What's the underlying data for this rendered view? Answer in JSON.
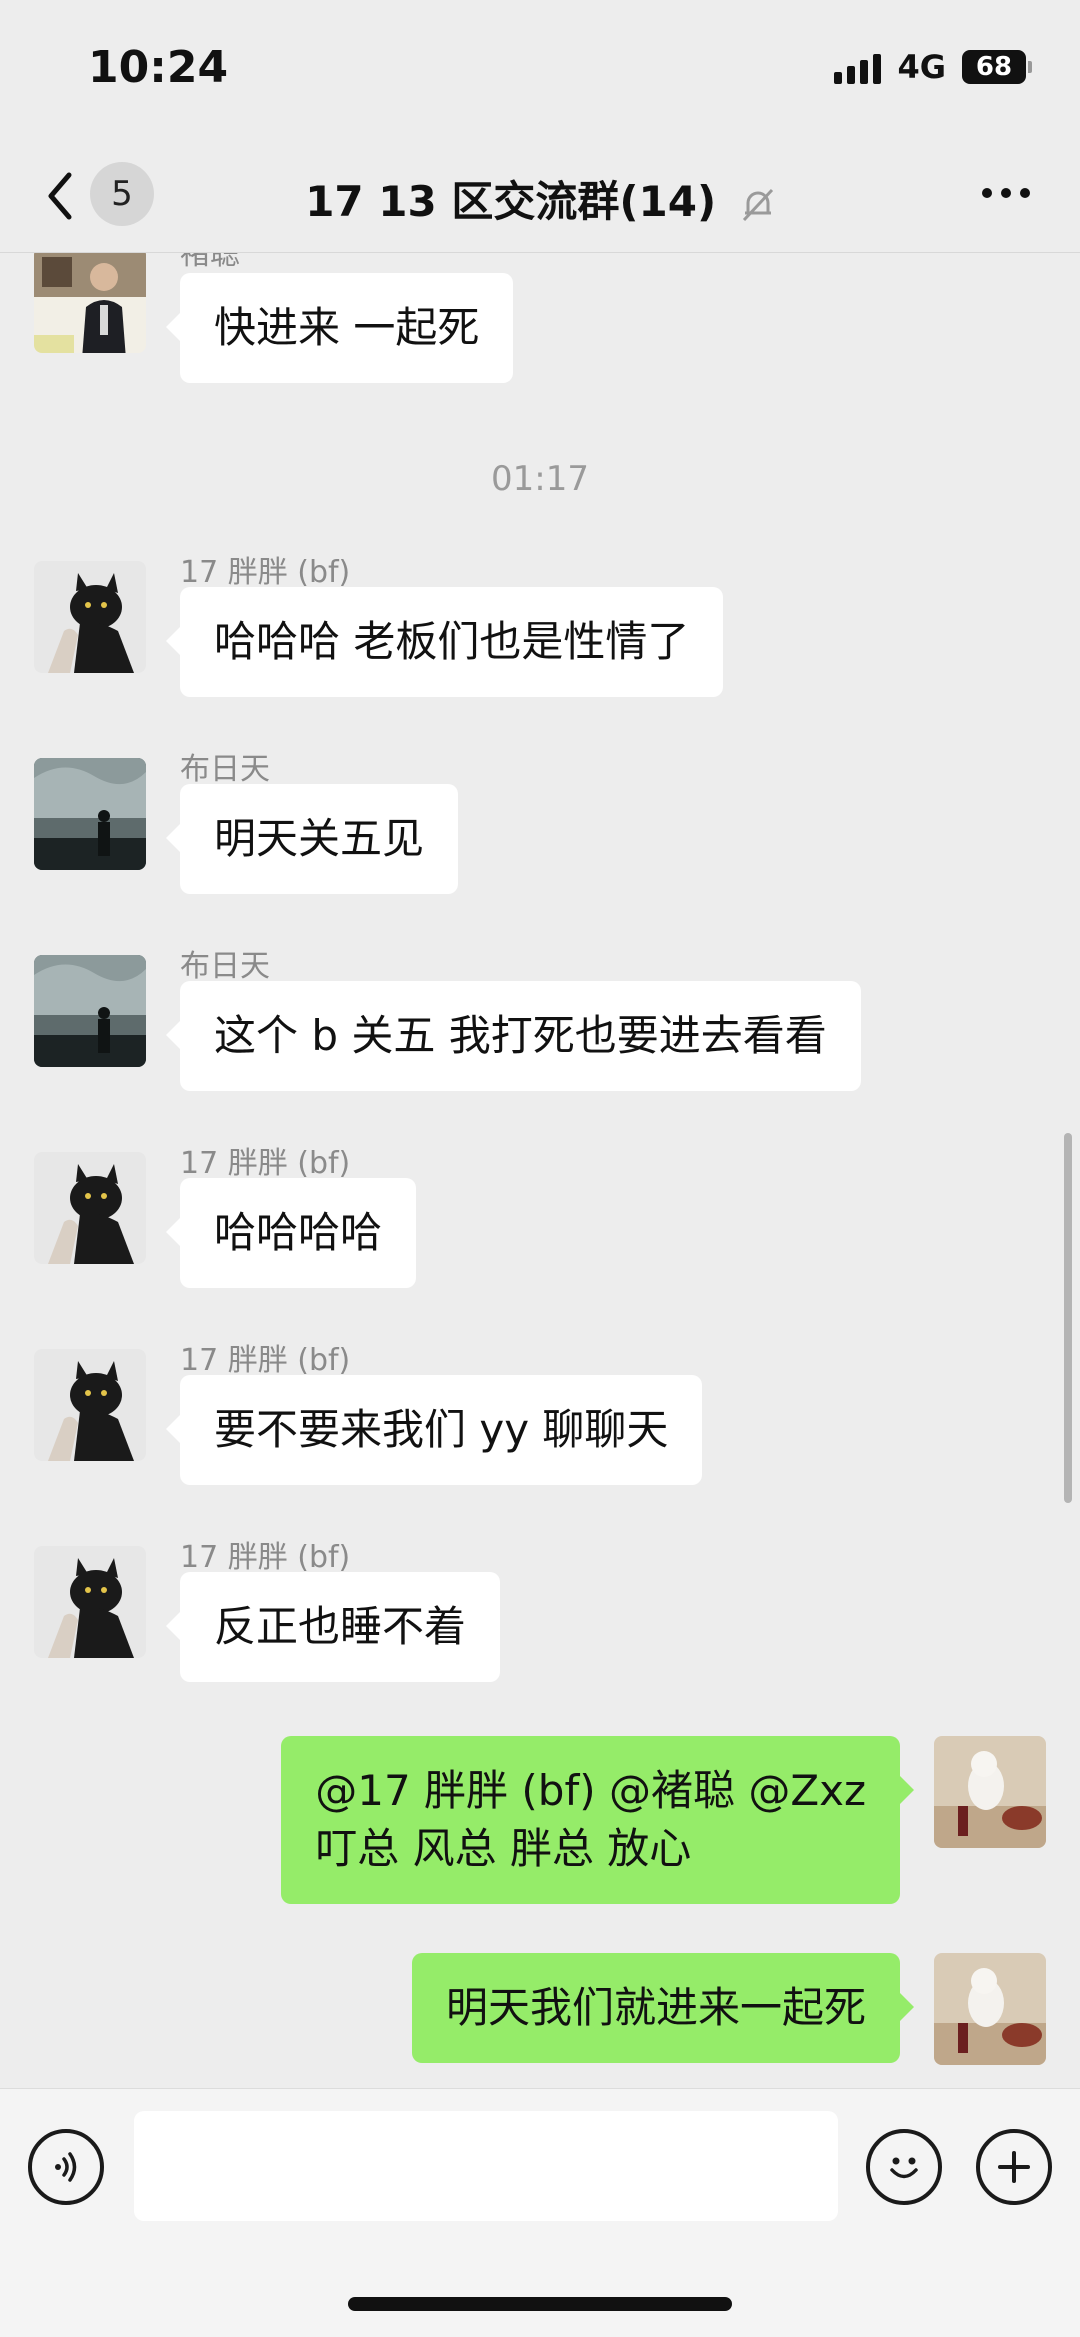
{
  "status_bar": {
    "time": "10:24",
    "network": "4G",
    "battery": "68"
  },
  "header": {
    "back_badge": "5",
    "title": "17 13 区交流群(14)"
  },
  "messages": {
    "m0": {
      "sender": "褚聪",
      "text": "快进来 一起死"
    },
    "timestamp": "01:17",
    "m1": {
      "sender": "17 胖胖 (bf)",
      "text": "哈哈哈 老板们也是性情了"
    },
    "m2": {
      "sender": "布日天",
      "text": "明天关五见"
    },
    "m3": {
      "sender": "布日天",
      "text": "这个 b 关五 我打死也要进去看看"
    },
    "m4": {
      "sender": "17 胖胖 (bf)",
      "text": "哈哈哈哈"
    },
    "m5": {
      "sender": "17 胖胖 (bf)",
      "text": "要不要来我们 yy 聊聊天"
    },
    "m6": {
      "sender": "17 胖胖 (bf)",
      "text": "反正也睡不着"
    },
    "m7": {
      "text": "@17 胖胖 (bf) @褚聪 @Zxz\n叮总 风总 胖总 放心"
    },
    "m8": {
      "text": "明天我们就进来一起死"
    }
  },
  "input_bar": {
    "value": "",
    "placeholder": ""
  },
  "icons": {
    "back": "chevron-left-icon",
    "mute": "bell-off-icon",
    "more": "more-dots-icon",
    "voice": "voice-icon",
    "emoji": "emoji-icon",
    "plus": "plus-icon"
  }
}
